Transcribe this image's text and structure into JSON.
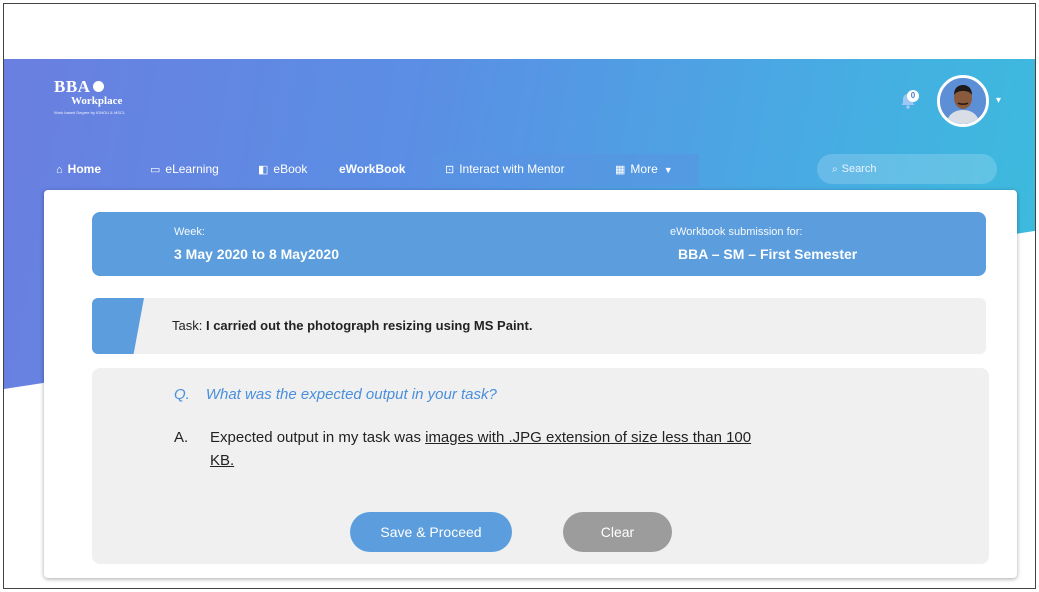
{
  "brand": {
    "name": "BBA",
    "sub": "Workplace",
    "tagline": "Work based Degree by IGNOU & MSCL"
  },
  "header": {
    "notification_count": "0"
  },
  "nav": {
    "home": "Home",
    "elearning": "eLearning",
    "ebook": "eBook",
    "eworkbook": "eWorkBook",
    "mentor": "Interact with Mentor",
    "more": "More"
  },
  "search": {
    "placeholder": "Search"
  },
  "week": {
    "label": "Week:",
    "value": "3 May 2020 to 8 May2020",
    "submission_label": "eWorkbook submission for:",
    "submission_value": "BBA – SM – First Semester"
  },
  "task": {
    "label": "Task:",
    "text": "I carried out the photograph resizing using MS Paint."
  },
  "qa": {
    "q_marker": "Q.",
    "question": "What was the expected output in your task?",
    "a_marker": "A.",
    "answer_prefix": "Expected output in my task was ",
    "answer_underlined": "images with .JPG extension of size less than 100 KB."
  },
  "buttons": {
    "save": "Save & Proceed",
    "clear": "Clear"
  },
  "colors": {
    "accent": "#5b9ddd",
    "question": "#4a8fdc",
    "panel": "#f0f0f0",
    "clear": "#9c9c9c"
  }
}
